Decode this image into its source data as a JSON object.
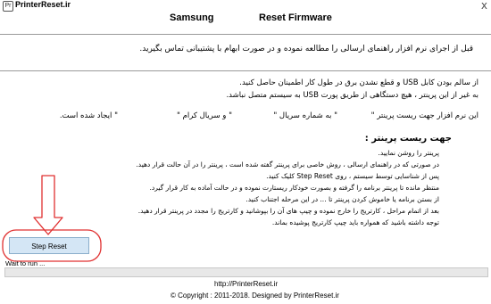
{
  "window": {
    "logo": "Pr",
    "title": "PrinterReset.ir",
    "close": "x"
  },
  "header": {
    "brand": "Samsung",
    "title": "Reset Firmware"
  },
  "warning": "قبل از اجرای نرم افزار راهنمای ارسالی را مطالعه نموده و در صورت ابهام با پشتیبانی تماس بگیرید.",
  "instructions": [
    "از سالم بودن کابل USB و قطع نشدن برق در طول کار اطمینان حاصل کنید.",
    "به غیر از این پرینتر ، هیچ دستگاهی از طریق پورت USB  به سیستم متصل نباشد."
  ],
  "serial_notice": {
    "part1": "این نرم افزار جهت ریست پرینتر  \"",
    "part2": "\" به شماره سریال  \"",
    "part3": "\" و سریال کرام  \"",
    "part4": "\" ایجاد شده است."
  },
  "procedure": {
    "title": "جهت ریست پرینتر :",
    "steps": [
      "پرینتر را روشن نمایید.",
      "در صورتی که در راهنمای ارسالی ، روش خاصی برای پرینتر گفته شده است ، پرینتر را در آن حالت قرار دهید.",
      "پس از شناسایی توسط سیستم ، روی  Step Reset  کلیک کنید.",
      "منتظر مانده تا پرینتر برنامه را گرفته و بصورت خودکار ریستارت نموده و در حالت آماده به کار قرار گیرد.",
      "از بستن برنامه یا خاموش کردن پرینتر تا ... در این مرحله اجتناب کنید.",
      "بعد از اتمام مراحل ، کارتریج را خارج نموده و چیپ های آن را بپوشانید و کارتریج را مجدد در پرینتر قرار دهید.",
      "توجه داشته باشید که همواره باید چیپ  کارتریج پوشیده بماند."
    ]
  },
  "step_reset_label": "Step  Reset",
  "status": "Wait to run ...",
  "progress": 0,
  "footer": {
    "url": "http://PrinterReset.ir",
    "copyright": "© Copyright : 2011-2018. Designed by PrinterReset.ir"
  },
  "colors": {
    "annotation": "#e03030",
    "button_bg": "#d4e6f5"
  }
}
